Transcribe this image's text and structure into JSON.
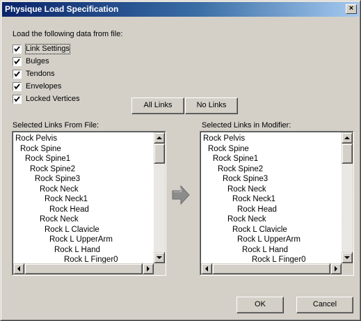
{
  "window": {
    "title": "Physique Load Specification",
    "close_glyph": "×"
  },
  "intro_label": "Load the following data from file:",
  "options": [
    {
      "label": "Link Settings",
      "checked": true
    },
    {
      "label": "Bulges",
      "checked": true
    },
    {
      "label": "Tendons",
      "checked": true
    },
    {
      "label": "Envelopes",
      "checked": true
    },
    {
      "label": "Locked Vertices",
      "checked": true
    }
  ],
  "buttons": {
    "all_links": "All Links",
    "no_links": "No Links",
    "ok": "OK",
    "cancel": "Cancel"
  },
  "left_list": {
    "label": "Selected Links From File:",
    "items": [
      "Rock Pelvis",
      "Rock Spine",
      "Rock Spine1",
      "Rock Spine2",
      "Rock Spine3",
      "Rock Neck",
      "Rock Neck1",
      "Rock Head",
      "Rock Neck",
      "Rock L Clavicle",
      "Rock L UpperArm",
      "Rock L Hand",
      "Rock L Finger0"
    ]
  },
  "right_list": {
    "label": "Selected Links in Modifier:",
    "items": [
      "Rock Pelvis",
      "Rock Spine",
      "Rock Spine1",
      "Rock Spine2",
      "Rock Spine3",
      "Rock Neck",
      "Rock Neck1",
      "Rock Head",
      "Rock Neck",
      "Rock L Clavicle",
      "Rock L UpperArm",
      "Rock L Hand",
      "Rock L Finger0"
    ]
  },
  "icons": {
    "transfer": "arrow-right-icon",
    "check": "checkmark-icon"
  }
}
